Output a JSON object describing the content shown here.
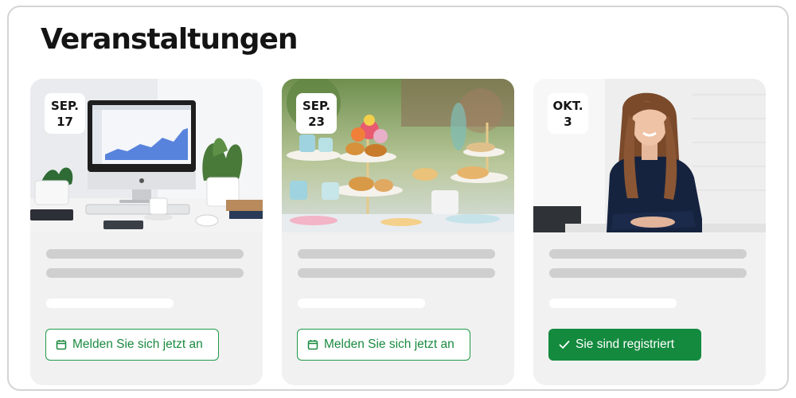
{
  "page": {
    "title": "Veranstaltungen"
  },
  "events": [
    {
      "date_month": "SEP.",
      "date_day": "17",
      "image": "desk-computer-analytics-photo",
      "button_label": "Melden Sie sich jetzt an",
      "button_icon": "calendar-icon",
      "registered": false
    },
    {
      "date_month": "SEP.",
      "date_day": "23",
      "image": "pastry-buffet-photo",
      "button_label": "Melden Sie sich jetzt an",
      "button_icon": "calendar-icon",
      "registered": false
    },
    {
      "date_month": "OKT.",
      "date_day": "3",
      "image": "smiling-woman-portrait-photo",
      "button_label": "Sie sind registriert",
      "button_icon": "check-icon",
      "registered": true
    }
  ],
  "colors": {
    "accent": "#138a3e",
    "card_bg": "#f1f1f1",
    "skeleton": "#cfcfcf"
  }
}
